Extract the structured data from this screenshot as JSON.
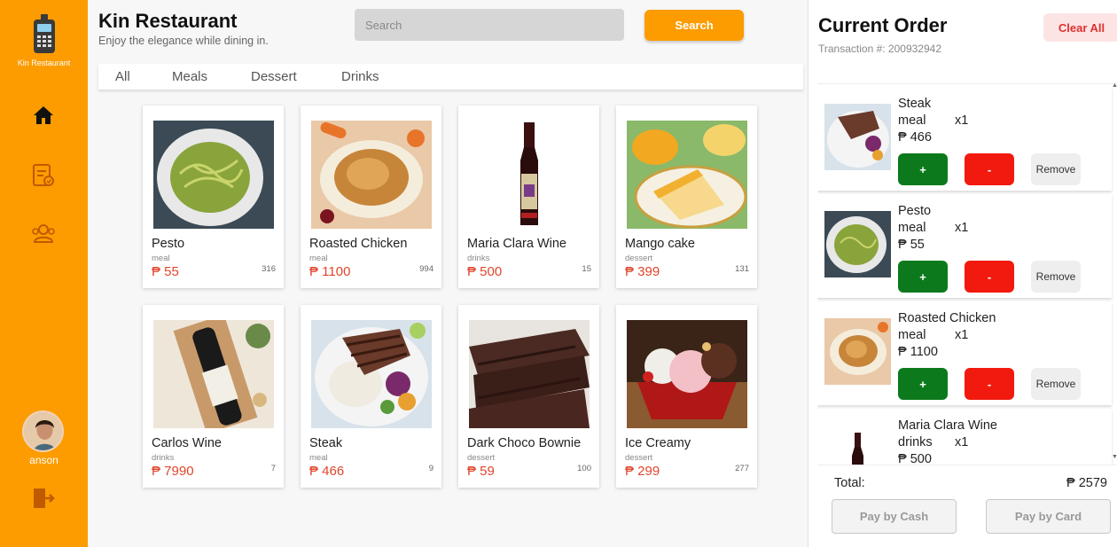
{
  "brand": {
    "logo_label": "Kin Restaurant"
  },
  "user": {
    "name": "anson"
  },
  "header": {
    "title": "Kin Restaurant",
    "subtitle": "Enjoy the elegance while dining in.",
    "search_placeholder": "Search",
    "search_button": "Search"
  },
  "tabs": [
    "All",
    "Meals",
    "Dessert",
    "Drinks"
  ],
  "products": [
    {
      "name": "Pesto",
      "category": "meal",
      "price": "₱ 55",
      "stock": "316"
    },
    {
      "name": "Roasted Chicken",
      "category": "meal",
      "price": "₱ 1100",
      "stock": "994"
    },
    {
      "name": "Maria Clara Wine",
      "category": "drinks",
      "price": "₱ 500",
      "stock": "15"
    },
    {
      "name": "Mango cake",
      "category": "dessert",
      "price": "₱ 399",
      "stock": "131"
    },
    {
      "name": "Carlos Wine",
      "category": "drinks",
      "price": "₱ 7990",
      "stock": "7"
    },
    {
      "name": "Steak",
      "category": "meal",
      "price": "₱ 466",
      "stock": "9"
    },
    {
      "name": "Dark Choco Bownie",
      "category": "dessert",
      "price": "₱ 59",
      "stock": "100"
    },
    {
      "name": "Ice Creamy",
      "category": "dessert",
      "price": "₱ 299",
      "stock": "277"
    }
  ],
  "order": {
    "title": "Current Order",
    "transaction": "Transaction #: 200932942",
    "clear_label": "Clear All",
    "items": [
      {
        "name": "Steak",
        "category": "meal",
        "qty": "x1",
        "price": "₱ 466"
      },
      {
        "name": "Pesto",
        "category": "meal",
        "qty": "x1",
        "price": "₱ 55"
      },
      {
        "name": "Roasted Chicken",
        "category": "meal",
        "qty": "x1",
        "price": "₱ 1100"
      },
      {
        "name": "Maria Clara Wine",
        "category": "drinks",
        "qty": "x1",
        "price": "₱ 500"
      }
    ],
    "plus_label": "+",
    "minus_label": "-",
    "remove_label": "Remove",
    "total_label": "Total:",
    "total_value": "₱ 2579",
    "pay_cash": "Pay by Cash",
    "pay_card": "Pay by Card"
  },
  "colors": {
    "accent": "#fc9c00",
    "price": "#e0452c",
    "plus": "#0c7a1c",
    "minus": "#f2190e"
  },
  "icons": {
    "logo": "pos-terminal-icon",
    "nav": [
      "home-icon",
      "orders-icon",
      "users-icon"
    ],
    "logout": "logout-icon"
  }
}
